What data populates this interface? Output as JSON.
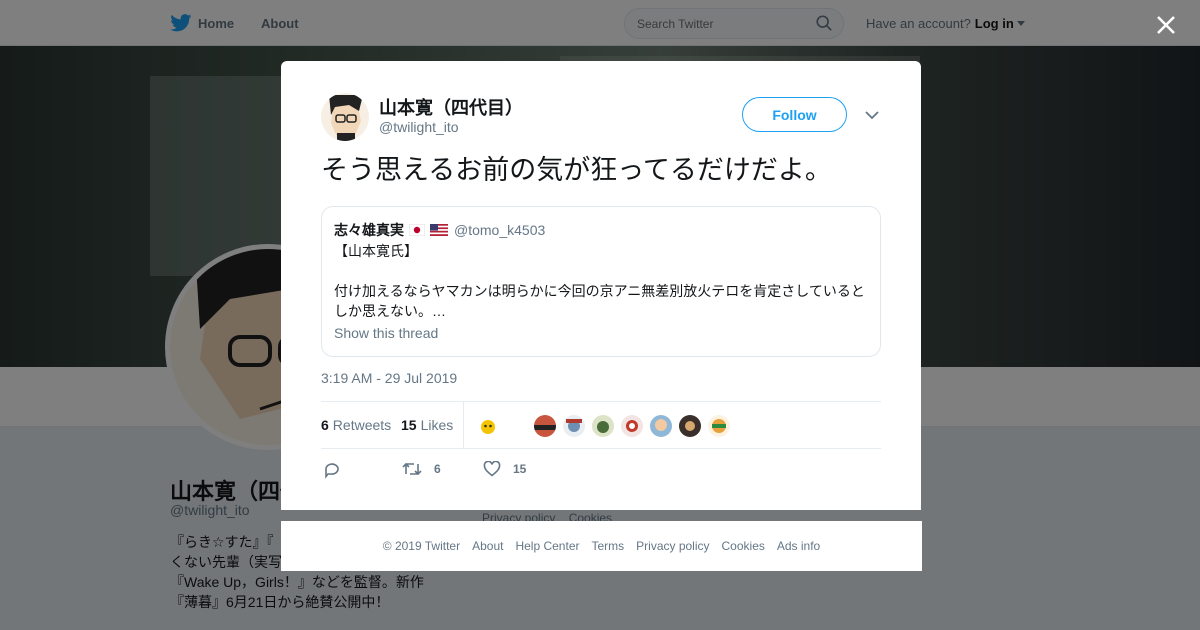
{
  "header": {
    "nav": [
      {
        "label": "Home"
      },
      {
        "label": "About"
      }
    ],
    "search_placeholder": "Search Twitter",
    "account_prompt": "Have an account?",
    "login_label": "Log in"
  },
  "profile": {
    "name": "山本寛（四代目）",
    "handle": "@twilight_ito",
    "bio_lines": [
      "『らき☆すた』『",
      "くない先輩（実写",
      "『Wake Up，Girls！』などを監督。新作",
      "『薄暮』6月21日から絶賛公開中！"
    ],
    "footer_links": [
      "Privacy policy",
      "Cookies"
    ]
  },
  "tweet": {
    "author_name": "山本寛（四代目）",
    "author_handle": "@twilight_ito",
    "follow_label": "Follow",
    "text": "そう思えるお前の気が狂ってるだけだよ。",
    "quoted": {
      "author_name": "志々雄真実",
      "author_handle": "@tomo_k4503",
      "lines": [
        "【山本寛氏】",
        "",
        "付け加えるならヤマカンは明らかに今回の京アニ無差別放火テロを肯定さしていると",
        "しか思えない。…"
      ],
      "show_thread": "Show this thread"
    },
    "timestamp": "3:19 AM - 29 Jul 2019",
    "stats": {
      "retweets_count": "6",
      "retweets_label": "Retweets",
      "likes_count": "15",
      "likes_label": "Likes"
    },
    "actions": {
      "retweet_count": "6",
      "like_count": "15"
    }
  },
  "footer": {
    "links": [
      "© 2019 Twitter",
      "About",
      "Help Center",
      "Terms",
      "Privacy policy",
      "Cookies",
      "Ads info"
    ]
  },
  "colors": {
    "accent": "#1da1f2",
    "secondary_text": "#657786",
    "overlay": "rgba(0,0,0,0.5)"
  },
  "icons": [
    "twitter-bird-icon",
    "search-icon",
    "close-icon",
    "chevron-down-icon",
    "reply-icon",
    "retweet-icon",
    "heart-icon"
  ]
}
